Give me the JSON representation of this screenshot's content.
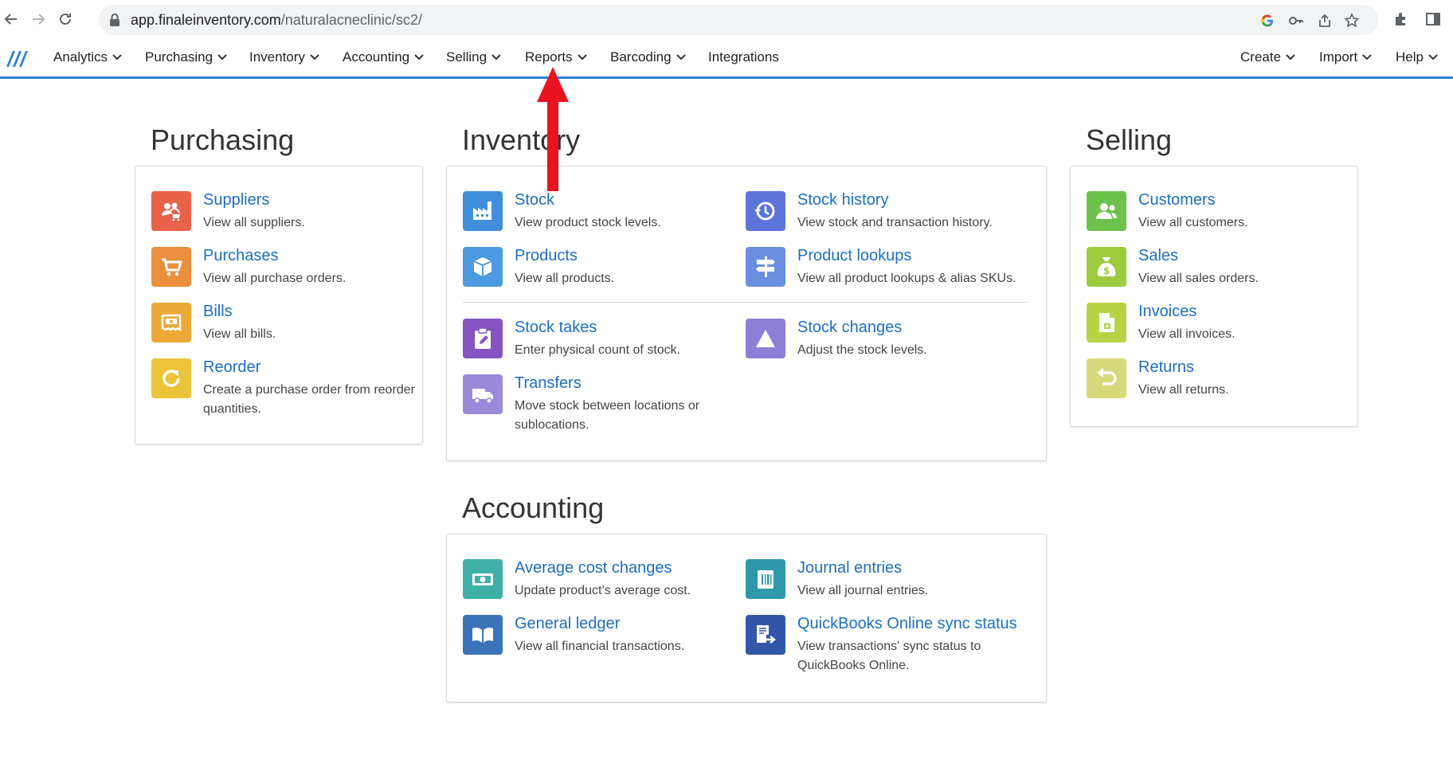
{
  "browser": {
    "url_host": "app.finaleinventory.com",
    "url_path": "/naturalacneclinic/sc2/"
  },
  "nav": {
    "left": [
      {
        "label": "Analytics"
      },
      {
        "label": "Purchasing"
      },
      {
        "label": "Inventory"
      },
      {
        "label": "Accounting"
      },
      {
        "label": "Selling"
      },
      {
        "label": "Reports"
      },
      {
        "label": "Barcoding"
      },
      {
        "label": "Integrations"
      }
    ],
    "right": [
      {
        "label": "Create"
      },
      {
        "label": "Import"
      },
      {
        "label": "Help"
      }
    ]
  },
  "purchasing": {
    "title": "Purchasing",
    "items": [
      {
        "title": "Suppliers",
        "desc": "View all suppliers.",
        "icon": "suppliers-icon",
        "color": "#e8634a"
      },
      {
        "title": "Purchases",
        "desc": "View all purchase orders.",
        "icon": "cart-icon",
        "color": "#ea8f3e"
      },
      {
        "title": "Bills",
        "desc": "View all bills.",
        "icon": "bill-icon",
        "color": "#eda938"
      },
      {
        "title": "Reorder",
        "desc": "Create a purchase order from reorder quantities.",
        "icon": "reorder-icon",
        "color": "#ecc43a"
      }
    ]
  },
  "inventory": {
    "title": "Inventory",
    "items": [
      {
        "title": "Stock",
        "desc": "View product stock levels.",
        "icon": "factory-icon",
        "color": "#3f8fdb"
      },
      {
        "title": "Stock history",
        "desc": "View stock and transaction history.",
        "icon": "history-icon",
        "color": "#5c74d9"
      },
      {
        "title": "Products",
        "desc": "View all products.",
        "icon": "box-icon",
        "color": "#4c9ae0"
      },
      {
        "title": "Product lookups",
        "desc": "View all product lookups & alias SKUs.",
        "icon": "signpost-icon",
        "color": "#6a8fe0"
      },
      {
        "title": "Stock takes",
        "desc": "Enter physical count of stock.",
        "icon": "clipboard-icon",
        "color": "#8553c2"
      },
      {
        "title": "Stock changes",
        "desc": "Adjust the stock levels.",
        "icon": "triangle-icon",
        "color": "#8d7fd6"
      },
      {
        "title": "Transfers",
        "desc": "Move stock between locations or sublocations.",
        "icon": "truck-icon",
        "color": "#9a88d8"
      }
    ]
  },
  "selling": {
    "title": "Selling",
    "items": [
      {
        "title": "Customers",
        "desc": "View all customers.",
        "icon": "customers-icon",
        "color": "#6cc24a"
      },
      {
        "title": "Sales",
        "desc": "View all sales orders.",
        "icon": "moneybag-icon",
        "color": "#9ccc3e"
      },
      {
        "title": "Invoices",
        "desc": "View all invoices.",
        "icon": "invoice-icon",
        "color": "#b8d246"
      },
      {
        "title": "Returns",
        "desc": "View all returns.",
        "icon": "return-icon",
        "color": "#d6d97a"
      }
    ]
  },
  "accounting": {
    "title": "Accounting",
    "items": [
      {
        "title": "Average cost changes",
        "desc": "Update product’s average cost.",
        "icon": "money-icon",
        "color": "#3fb0a8"
      },
      {
        "title": "Journal entries",
        "desc": "View all journal entries.",
        "icon": "journal-icon",
        "color": "#2f98a8"
      },
      {
        "title": "General ledger",
        "desc": "View all financial transactions.",
        "icon": "ledger-icon",
        "color": "#3a73b8"
      },
      {
        "title": "QuickBooks Online sync status",
        "desc": "View transactions' sync status to QuickBooks Online.",
        "icon": "sync-icon",
        "color": "#3456a8"
      }
    ]
  }
}
